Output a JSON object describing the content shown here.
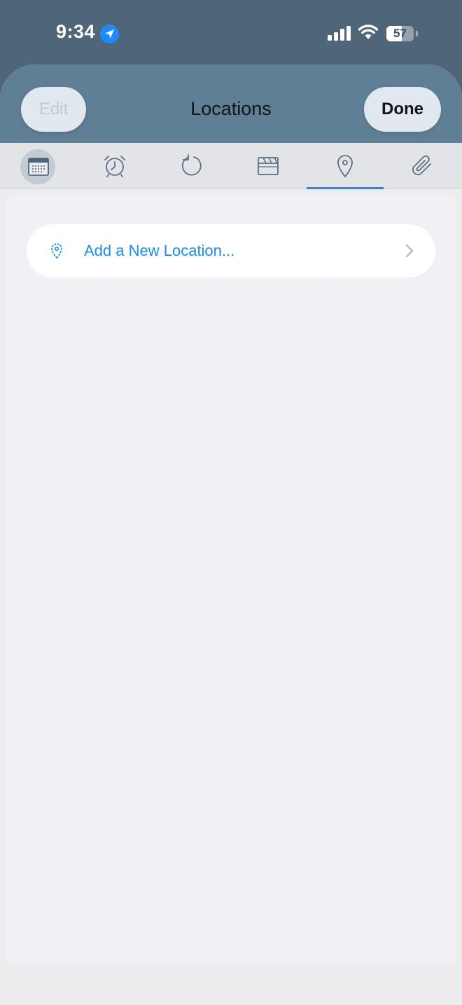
{
  "status_bar": {
    "time": "9:34",
    "battery": "57",
    "battery_level": 0.57
  },
  "nav": {
    "title": "Locations",
    "edit_label": "Edit",
    "done_label": "Done"
  },
  "tabs": [
    {
      "icon": "calendar-icon",
      "selected_background": true
    },
    {
      "icon": "alarm-clock-icon"
    },
    {
      "icon": "repeat-icon"
    },
    {
      "icon": "clapperboard-icon"
    },
    {
      "icon": "location-pin-icon",
      "active": true
    },
    {
      "icon": "paperclip-icon"
    }
  ],
  "locations": {
    "add_label": "Add a New Location..."
  },
  "colors": {
    "accent": "#1a8cff",
    "header": "#5f7f95",
    "status_bar_bg": "#4f6578",
    "content_bg": "#f0f0f5",
    "icon": "#5a7085"
  }
}
